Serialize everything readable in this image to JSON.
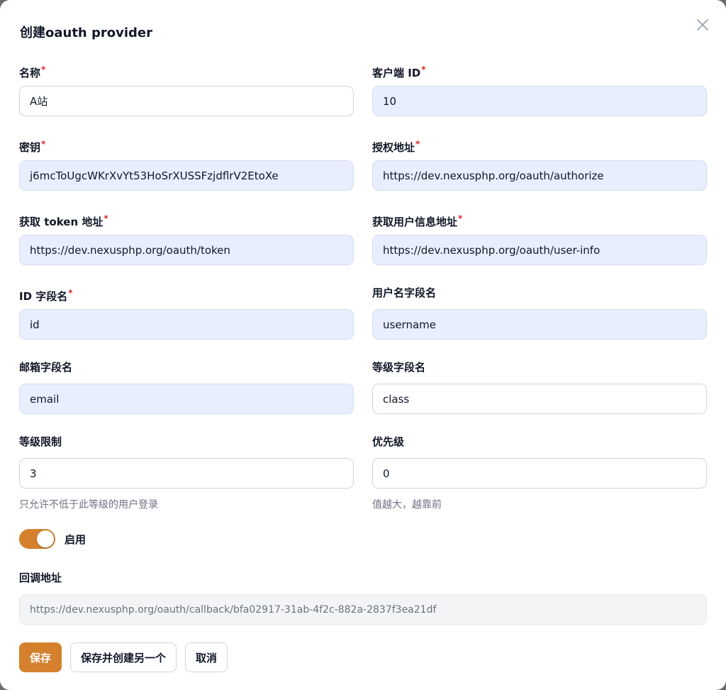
{
  "title": "创建oauth provider",
  "fields": {
    "name": {
      "label": "名称",
      "value": "A站"
    },
    "client_id": {
      "label": "客户端 ID",
      "value": "10"
    },
    "secret": {
      "label": "密钥",
      "value": "j6mcToUgcWKrXvYt53HoSrXUSSFzjdflrV2EtoXe"
    },
    "authorize_url": {
      "label": "授权地址",
      "value": "https://dev.nexusphp.org/oauth/authorize"
    },
    "token_url": {
      "label": "获取 token 地址",
      "value": "https://dev.nexusphp.org/oauth/token"
    },
    "user_info_url": {
      "label": "获取用户信息地址",
      "value": "https://dev.nexusphp.org/oauth/user-info"
    },
    "id_field": {
      "label": "ID 字段名",
      "value": "id"
    },
    "username_field": {
      "label": "用户名字段名",
      "value": "username"
    },
    "email_field": {
      "label": "邮箱字段名",
      "value": "email"
    },
    "level_field": {
      "label": "等级字段名",
      "value": "class"
    },
    "level_limit": {
      "label": "等级限制",
      "value": "3",
      "hint": "只允许不低于此等级的用户登录"
    },
    "priority": {
      "label": "优先级",
      "value": "0",
      "hint": "值越大，越靠前"
    }
  },
  "enabled": {
    "label": "启用",
    "on": true
  },
  "callback": {
    "label": "回调地址",
    "value": "https://dev.nexusphp.org/oauth/callback/bfa02917-31ab-4f2c-882a-2837f3ea21df"
  },
  "buttons": {
    "save": "保存",
    "save_and_create": "保存并创建另一个",
    "cancel": "取消"
  },
  "required_mark": "*",
  "colors": {
    "accent": "#d4802d",
    "required": "#dc2626",
    "autofill_bg": "#e8eefd"
  }
}
